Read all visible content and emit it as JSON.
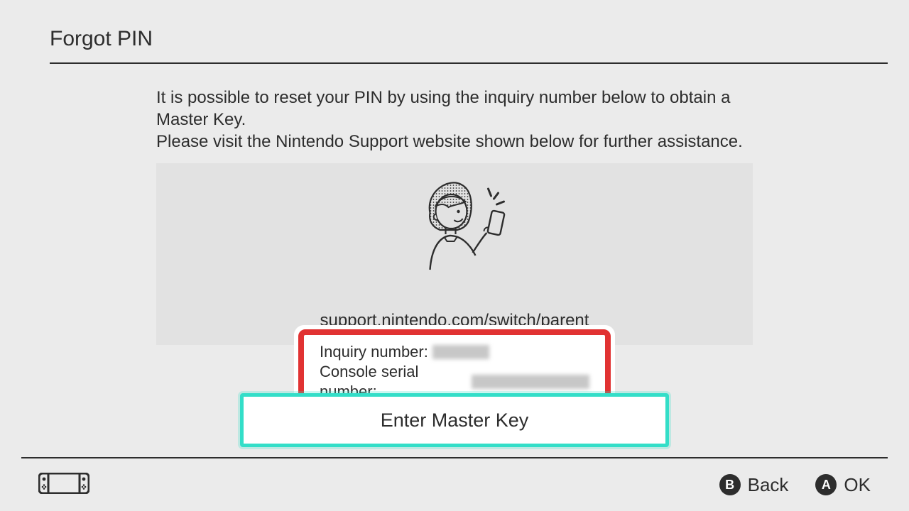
{
  "header": {
    "title": "Forgot PIN"
  },
  "body": {
    "line1": "It is possible to reset your PIN by using the inquiry number below to obtain a Master Key.",
    "line2": "Please visit the Nintendo Support website shown below for further assistance.",
    "support_url": "support.nintendo.com/switch/parent",
    "inquiry_label": "Inquiry number:",
    "serial_label": "Console serial number:"
  },
  "button": {
    "enter_master_key": "Enter Master Key"
  },
  "footer": {
    "b_glyph": "B",
    "b_label": "Back",
    "a_glyph": "A",
    "a_label": "OK"
  }
}
